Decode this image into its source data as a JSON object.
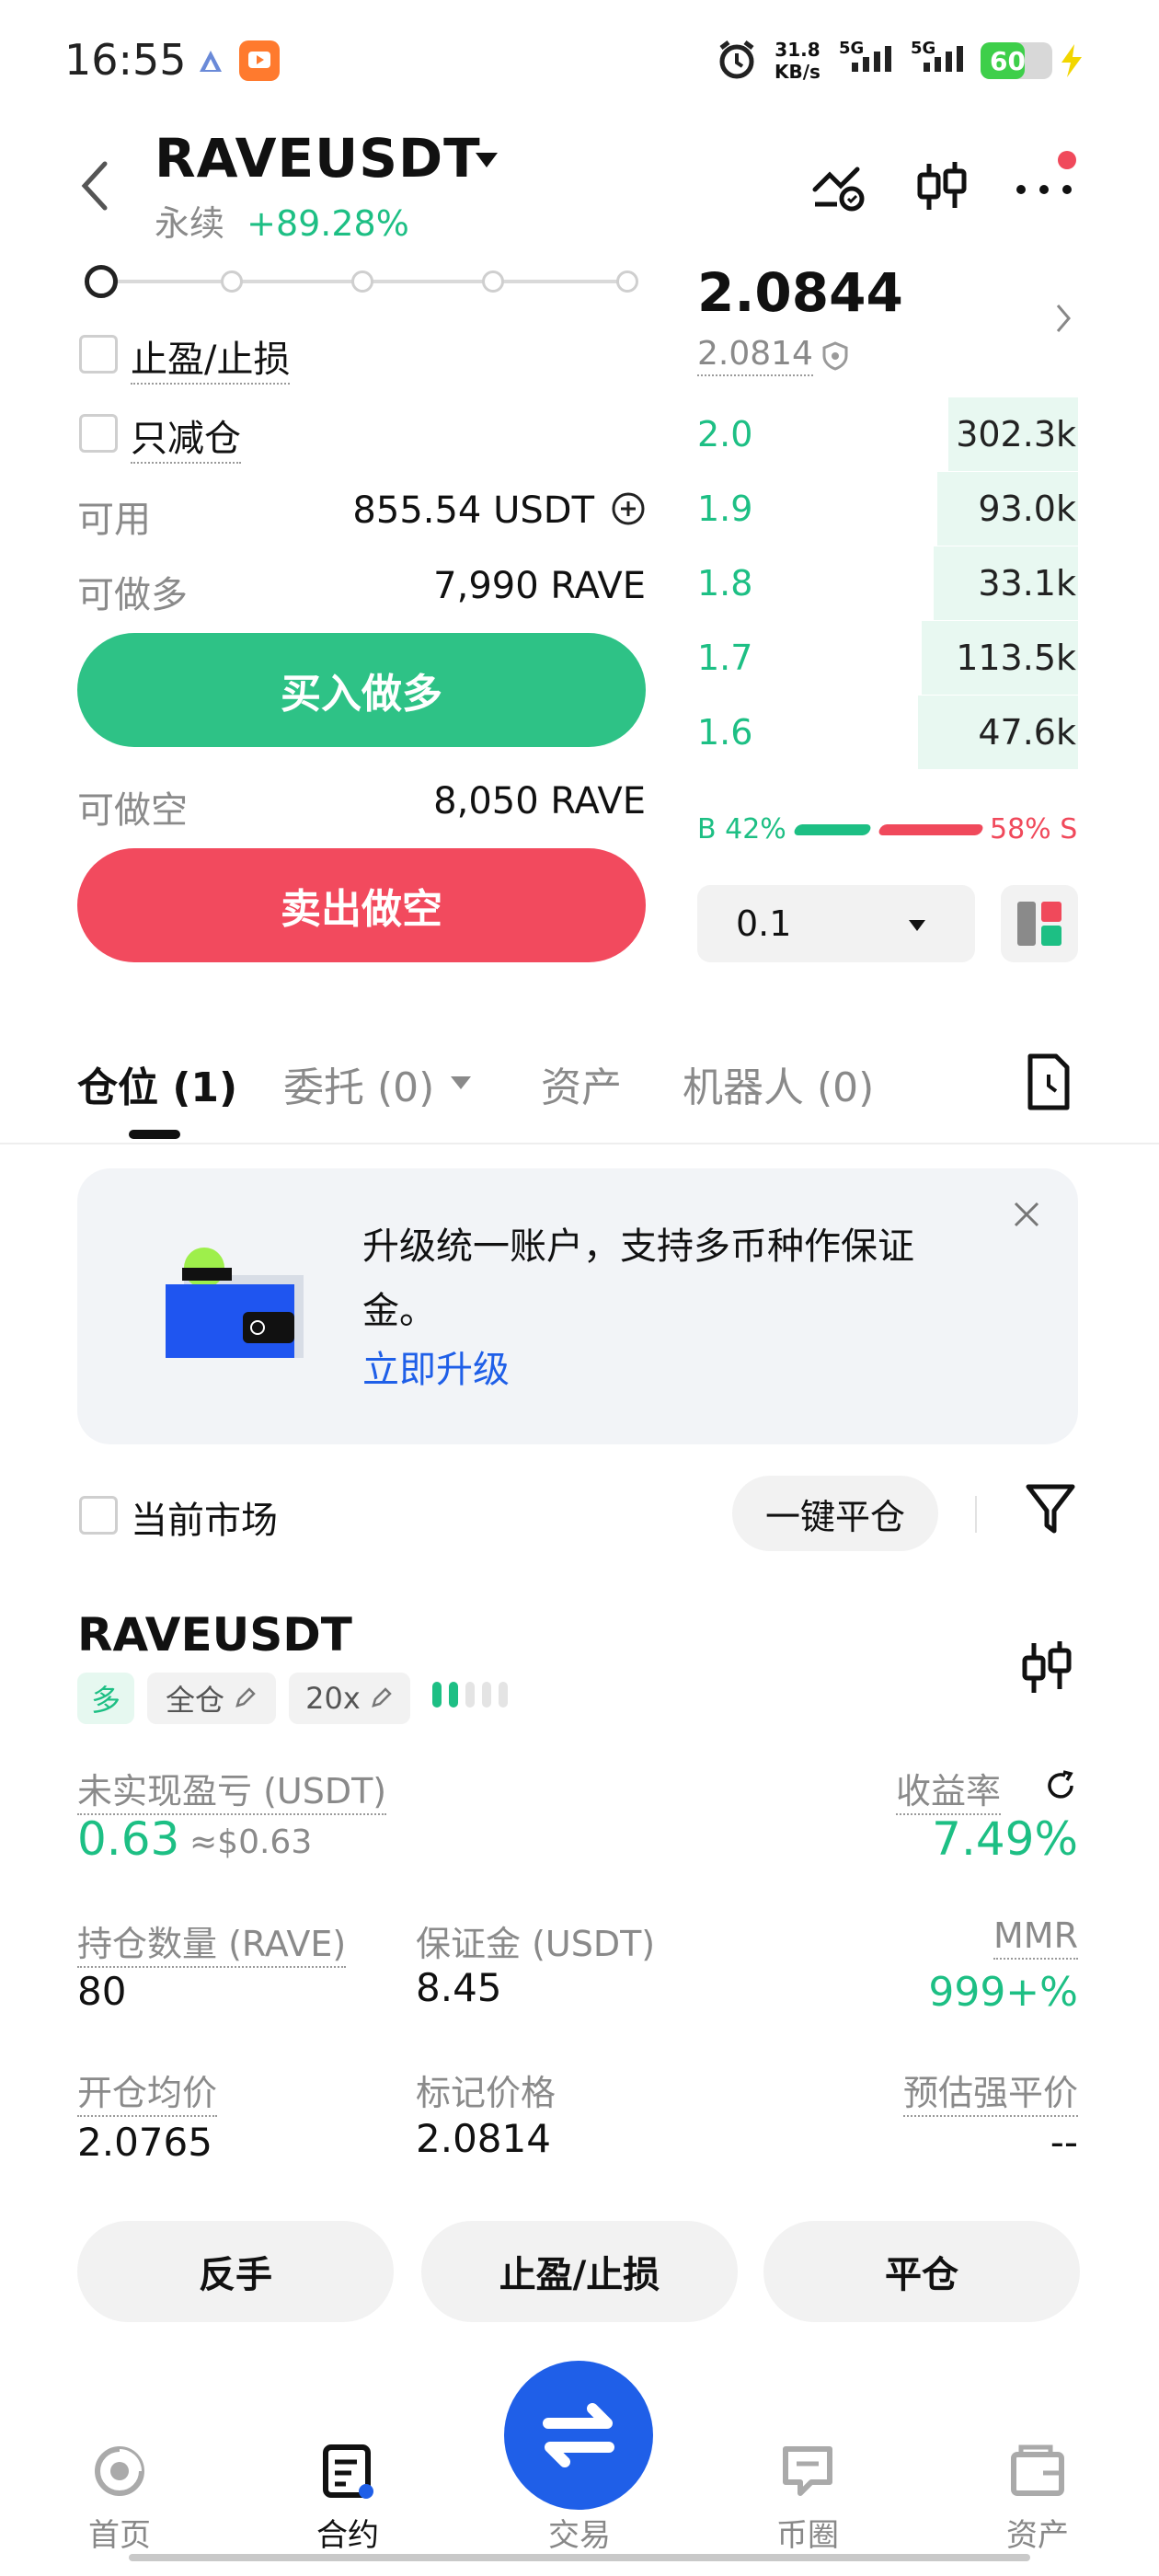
{
  "status": {
    "time": "16:55",
    "speed_value": "31.8",
    "speed_unit": "KB/s",
    "net1": "5G",
    "net2": "5G",
    "battery": "60"
  },
  "header": {
    "pair": "RAVEUSDT",
    "type": "永续",
    "change": "+89.28%"
  },
  "form": {
    "tp_sl_label": "止盈/止损",
    "reduce_only_label": "只减仓",
    "available_label": "可用",
    "available_value": "855.54 USDT",
    "long_label": "可做多",
    "long_value": "7,990 RAVE",
    "buy_button": "买入做多",
    "short_label": "可做空",
    "short_value": "8,050 RAVE",
    "sell_button": "卖出做空"
  },
  "orderbook": {
    "last_price": "2.0844",
    "mark_price": "2.0814",
    "bids": [
      {
        "price": "2.0",
        "qty": "302.3k",
        "depth": 0.34
      },
      {
        "price": "1.9",
        "qty": "93.0k",
        "depth": 0.37
      },
      {
        "price": "1.8",
        "qty": "33.1k",
        "depth": 0.38
      },
      {
        "price": "1.7",
        "qty": "113.5k",
        "depth": 0.41
      },
      {
        "price": "1.6",
        "qty": "47.6k",
        "depth": 0.42
      }
    ],
    "buy_ratio": "B 42%",
    "sell_ratio": "58% S",
    "step": "0.1",
    "colors": {
      "buy": "#1dbf84",
      "sell": "#f0495b"
    }
  },
  "tabs": {
    "positions": "仓位 (1)",
    "orders": "委托 (0)",
    "assets": "资产",
    "bots": "机器人 (0)"
  },
  "banner": {
    "text": "升级统一账户，支持多币种作保证金。",
    "link": "立即升级"
  },
  "filter": {
    "current_market": "当前市场",
    "close_all": "一键平仓"
  },
  "position": {
    "pair": "RAVEUSDT",
    "side": "多",
    "margin_mode": "全仓",
    "leverage": "20x",
    "upnl_label": "未实现盈亏 (USDT)",
    "upnl_value": "0.63",
    "upnl_usd": "≈$0.63",
    "roe_label": "收益率",
    "roe_value": "7.49%",
    "size_label": "持仓数量 (RAVE)",
    "size_value": "80",
    "margin_label": "保证金 (USDT)",
    "margin_value": "8.45",
    "mmr_label": "MMR",
    "mmr_value": "999+%",
    "entry_label": "开仓均价",
    "entry_value": "2.0765",
    "mark_label": "标记价格",
    "mark_value": "2.0814",
    "liq_label": "预估强平价",
    "liq_value": "--",
    "btn_reverse": "反手",
    "btn_tpsl": "止盈/止损",
    "btn_close": "平仓"
  },
  "nav": {
    "home": "首页",
    "contract": "合约",
    "trade": "交易",
    "community": "币圈",
    "assets": "资产"
  }
}
